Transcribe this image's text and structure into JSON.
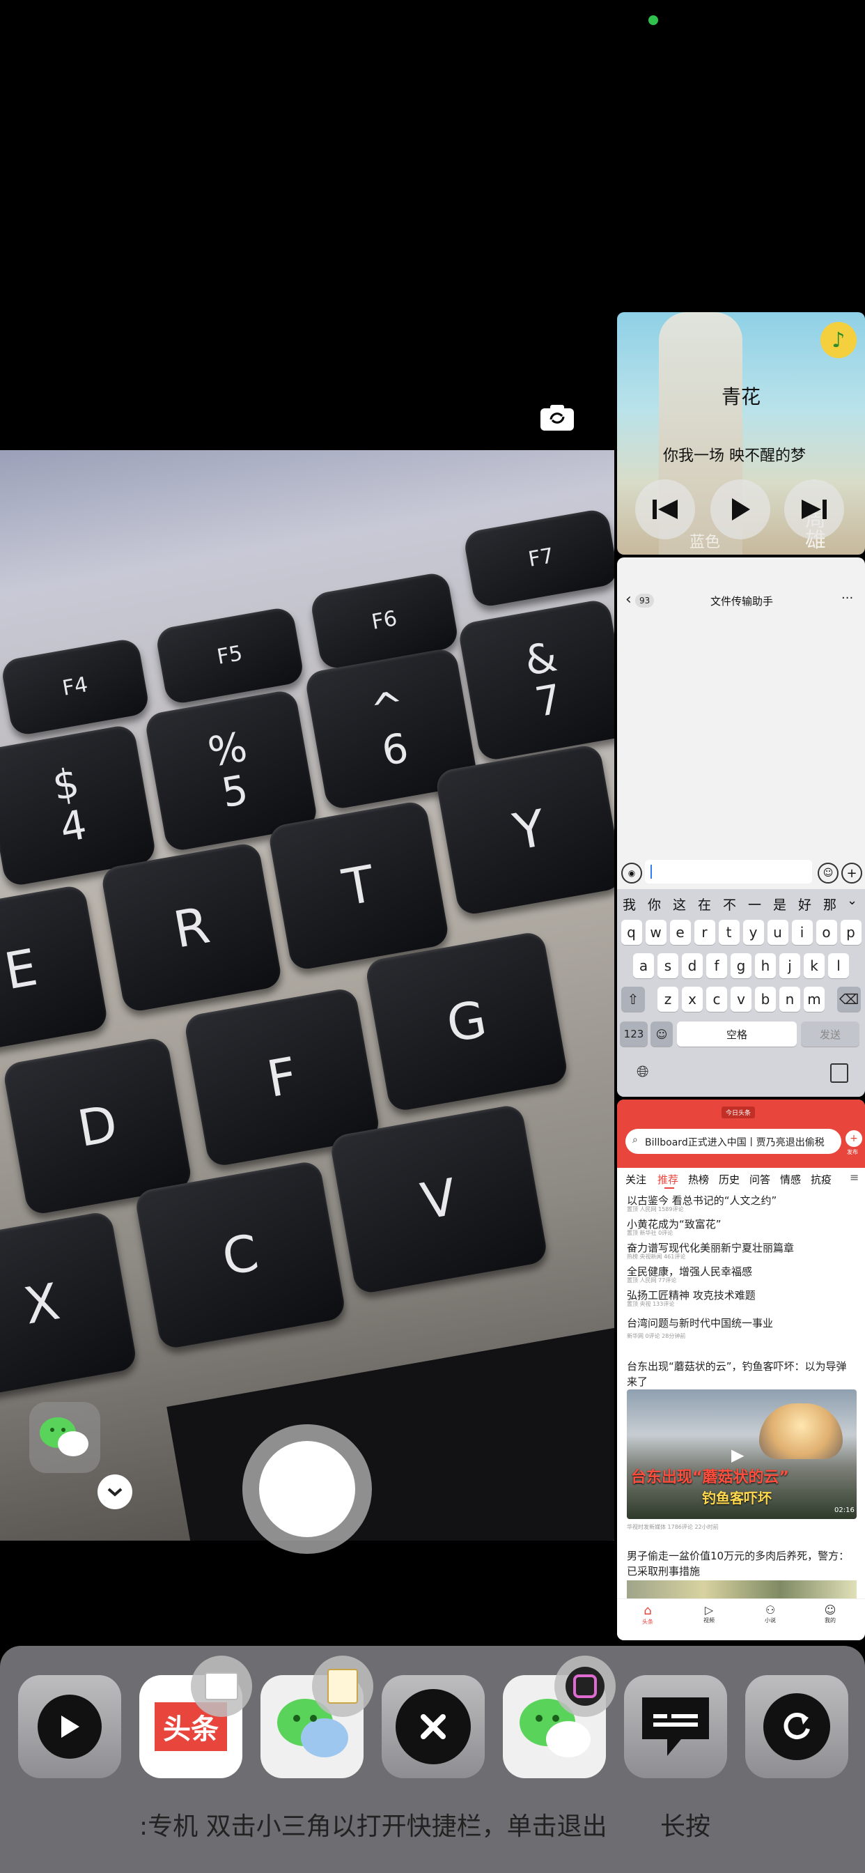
{
  "status": {
    "indicator_color": "#2fc24d"
  },
  "camera": {
    "keys": [
      "F4",
      "F5",
      "F6",
      "F7",
      "$",
      "4",
      "%",
      "5",
      "^",
      "6",
      "&",
      "7",
      "E",
      "R",
      "T",
      "Y",
      "D",
      "F",
      "G",
      "X",
      "C",
      "V"
    ],
    "shutter": "capture"
  },
  "music": {
    "title": "青花",
    "lyric": "你我一场 映不醒的梦",
    "album_text_1": "周",
    "album_text_2": "雄",
    "album_text_3": "蓝色"
  },
  "wechat": {
    "back_count": "93",
    "title": "文件传输助手",
    "more": "···",
    "suggestions": [
      "我",
      "你",
      "这",
      "在",
      "不",
      "一",
      "是",
      "好",
      "那"
    ],
    "row1": [
      "q",
      "w",
      "e",
      "r",
      "t",
      "y",
      "u",
      "i",
      "o",
      "p"
    ],
    "row2": [
      "a",
      "s",
      "d",
      "f",
      "g",
      "h",
      "j",
      "k",
      "l"
    ],
    "row3": [
      "z",
      "x",
      "c",
      "v",
      "b",
      "n",
      "m"
    ],
    "key_123": "123",
    "key_space": "空格",
    "key_send": "发送"
  },
  "news": {
    "top_badge": "今日头条",
    "search_text": "Billboard正式进入中国丨贾乃亮退出偷税",
    "publish_label": "发布",
    "tabs": [
      "关注",
      "推荐",
      "热榜",
      "历史",
      "问答",
      "情感",
      "抗疫"
    ],
    "headlines": [
      {
        "title": "以古鉴今 看总书记的“人文之约”",
        "meta": "置顶 人民网 1589评论"
      },
      {
        "title": "小黄花成为“致富花”",
        "meta": "置顶 新华社 0评论"
      },
      {
        "title": "奋力谱写现代化美丽新宁夏壮丽篇章",
        "meta": "热榜 央视新闻 461评论"
      },
      {
        "title": "全民健康，增强人民幸福感",
        "meta": "置顶 人民网 77评论"
      },
      {
        "title": "弘扬工匠精神 攻克技术难题",
        "meta": "置顶 央视 133评论"
      },
      {
        "title": "台湾问题与新时代中国统一事业",
        "meta": "新华网 0评论 28分钟前"
      },
      {
        "title": "台东出现“蘑菇状的云”，钓鱼客吓坏：以为导弹来了",
        "meta": ""
      },
      {
        "title": "男子偷走一盆价值10万元的多肉后养死，警方：已采取刑事措施",
        "meta": ""
      }
    ],
    "video_caption_1": "台东出现“蘑菇状的云”",
    "video_caption_2": "钓鱼客吓坏",
    "video_duration": "02:16",
    "video_meta": "华视时发新媒体 1786评论 22小时前",
    "nav": [
      "头条",
      "视频",
      "小说",
      "我的"
    ]
  },
  "dock": {
    "marquee": ":专机 双击小三角以打开快捷栏，单击退出",
    "marquee_2": "长按",
    "apps": [
      "play-app",
      "toutiao-app",
      "wechat-app",
      "close-app",
      "wechat-app-2",
      "messages-app",
      "refresh-app"
    ],
    "toutiao_label": "头条"
  }
}
